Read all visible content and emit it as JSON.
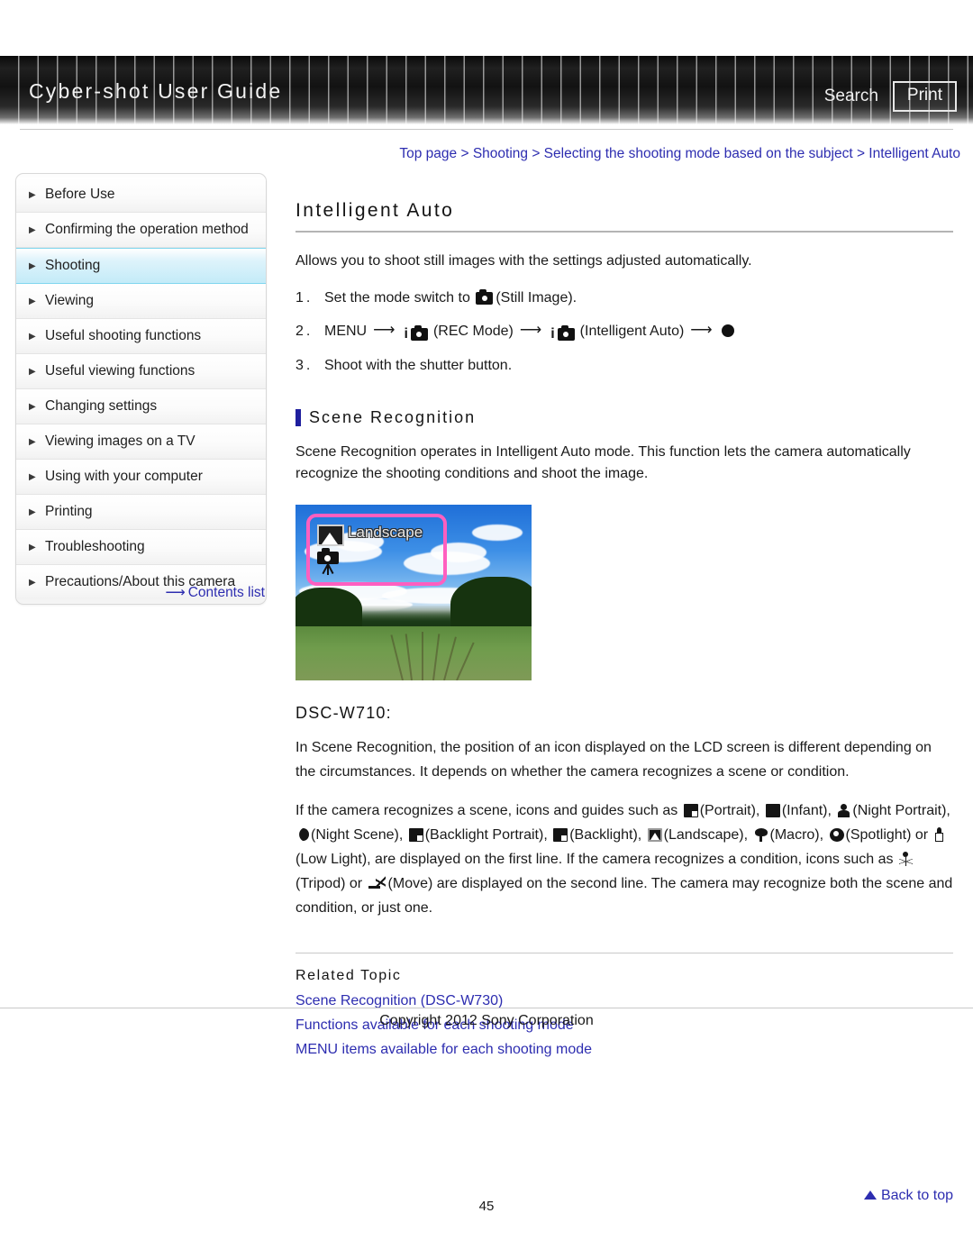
{
  "header": {
    "title": "Cyber-shot User Guide",
    "search_label": "Search",
    "print_label": "Print"
  },
  "breadcrumb": {
    "text": "Top page > Shooting > Selecting the shooting mode based on the subject > Intelligent Auto"
  },
  "sidebar": {
    "items": [
      {
        "label": "Before Use",
        "active": false
      },
      {
        "label": "Confirming the operation method",
        "active": false
      },
      {
        "label": "Shooting",
        "active": true
      },
      {
        "label": "Viewing",
        "active": false
      },
      {
        "label": "Useful shooting functions",
        "active": false
      },
      {
        "label": "Useful viewing functions",
        "active": false
      },
      {
        "label": "Changing settings",
        "active": false
      },
      {
        "label": "Viewing images on a TV",
        "active": false
      },
      {
        "label": "Using with your computer",
        "active": false
      },
      {
        "label": "Printing",
        "active": false
      },
      {
        "label": "Troubleshooting",
        "active": false
      },
      {
        "label": "Precautions/About this camera",
        "active": false
      }
    ],
    "contents_list_label": "Contents list",
    "arrow_glyph": "⟶"
  },
  "main": {
    "title": "Intelligent Auto",
    "intro": "Allows you to shoot still images with the settings adjusted automatically.",
    "steps": [
      {
        "num": "1.",
        "pre": "Set the mode switch to ",
        "post": "(Still Image)."
      },
      {
        "num": "2.",
        "pre": "MENU",
        "label_rec": "(REC Mode)",
        "label_ia": "(Intelligent Auto)",
        "arrow": "⟶"
      },
      {
        "num": "3.",
        "pre": "Shoot with the shutter button.",
        "post": ""
      }
    ],
    "section": {
      "title": "Scene Recognition",
      "paragraph": "Scene Recognition operates in Intelligent Auto mode. This function lets the camera automatically recognize the shooting conditions and shoot the image."
    },
    "figure": {
      "overlay_label": "Landscape",
      "mountain_icon": "mountain-icon",
      "tripod_icon": "tripod-camera-icon",
      "highlight_color": "#ff5fc0"
    },
    "model": {
      "title": "DSC-W710:",
      "para1": "In Scene Recognition, the position of an icon displayed on the LCD screen is different depending on the circumstances. It depends on whether the camera recognizes a scene or condition.",
      "para2_parts": {
        "p1": "If the camera recognizes a scene, icons and guides such as ",
        "l_portrait": "(Portrait), ",
        "l_infant": "(Infant), ",
        "l_night_portrait": "(Night Portrait), ",
        "l_night_scene": "(Night Scene), ",
        "l_backlight_portrait": "(Backlight Portrait), ",
        "l_backlight": "(Backlight), ",
        "l_landscape": "(Landscape), ",
        "l_macro": "(Macro), ",
        "l_spotlight": "(Spotlight) or ",
        "l_low_light": "(Low Light), are displayed on the first line. If the camera recognizes a condition, icons such as ",
        "l_tripod": "(Tripod) or ",
        "l_move": "(Move) are displayed on the second line. The camera may recognize both the scene and condition, or just one."
      }
    },
    "related": {
      "title": "Related Topic",
      "links": [
        "Scene Recognition (DSC-W730)",
        "Functions available for each shooting mode",
        "MENU items available for each shooting mode"
      ]
    }
  },
  "footer": {
    "back_to_top": "Back to top",
    "copyright": "Copyright 2012 Sony Corporation",
    "page_number": "45"
  }
}
